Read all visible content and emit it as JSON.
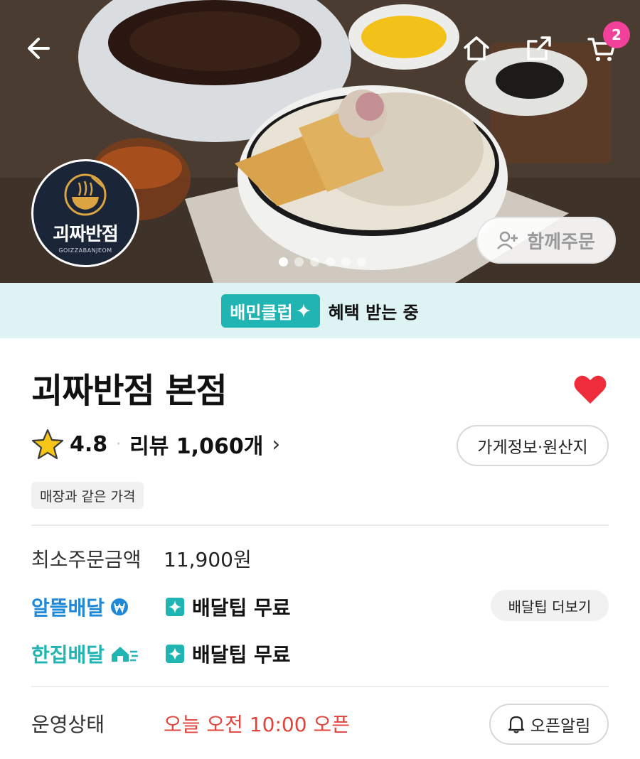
{
  "hero": {
    "cart_count": "2",
    "logo": {
      "name": "괴짜반점",
      "sub": "GOIZZABANJEOM"
    },
    "group_order_label": "함께주문",
    "slides": {
      "count": 6,
      "active": 1
    }
  },
  "club_banner": {
    "badge": "배민클럽",
    "text": "혜택 받는 중"
  },
  "store": {
    "name": "괴짜반점 본점",
    "favorited": true,
    "rating": "4.8",
    "review_label": "리뷰 1,060개",
    "info_button": "가게정보·원산지",
    "price_tag": "매장과 같은 가격"
  },
  "min_order": {
    "label": "최소주문금액",
    "value": "11,900원"
  },
  "delivery_options": [
    {
      "label": "알뜰배달",
      "tip": "배달팁 무료",
      "color": "#1e88d9",
      "icon": "won-coin-icon"
    },
    {
      "label": "한집배달",
      "tip": "배달팁 무료",
      "color": "#20b5b3",
      "icon": "fast-home-icon"
    }
  ],
  "tip_more_button": "배달팁 더보기",
  "status": {
    "label": "운영상태",
    "value": "오늘 오전 10:00 오픈",
    "alarm_button": "오픈알림"
  },
  "colors": {
    "accent": "#20b5b3",
    "badge": "#f2419a",
    "heart": "#ee2c3c",
    "status": "#e0453d"
  }
}
